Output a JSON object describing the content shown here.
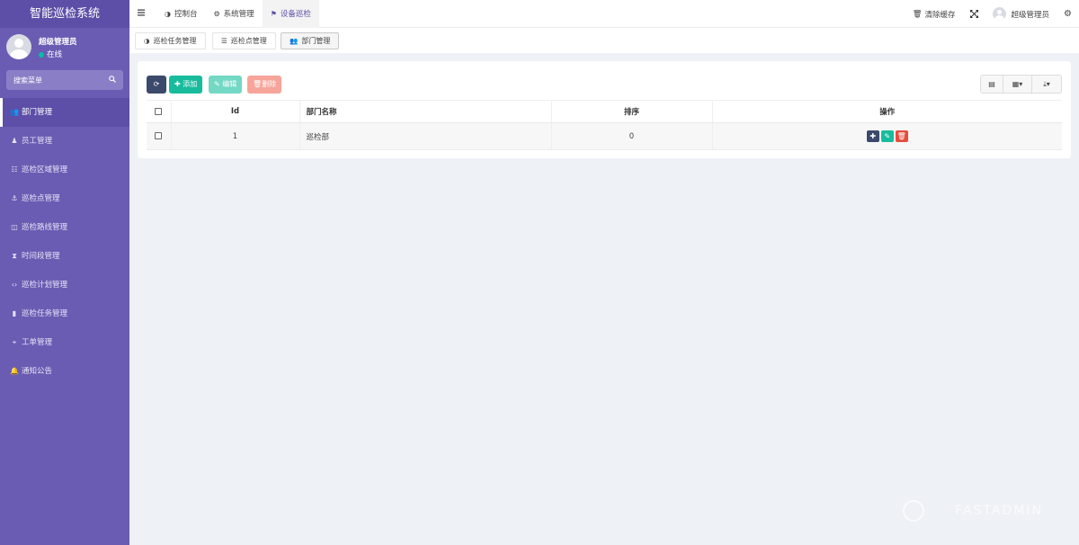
{
  "app": {
    "title": "智能巡检系统"
  },
  "user": {
    "name": "超级管理员",
    "status": "在线"
  },
  "search": {
    "placeholder": "搜索菜单"
  },
  "sidebar": {
    "items": [
      {
        "label": "部门管理",
        "icon": "users-icon",
        "glyph": "👥"
      },
      {
        "label": "员工管理",
        "icon": "user-icon",
        "glyph": "♟"
      },
      {
        "label": "巡检区域管理",
        "icon": "area-icon",
        "glyph": "☷"
      },
      {
        "label": "巡检点管理",
        "icon": "anchor-icon",
        "glyph": "⚓"
      },
      {
        "label": "巡检路线管理",
        "icon": "map-icon",
        "glyph": "◫"
      },
      {
        "label": "时间段管理",
        "icon": "hourglass-icon",
        "glyph": "⧗"
      },
      {
        "label": "巡检计划管理",
        "icon": "code-icon",
        "glyph": "‹›"
      },
      {
        "label": "巡检任务管理",
        "icon": "bookmark-icon",
        "glyph": "▮"
      },
      {
        "label": "工单管理",
        "icon": "crosshair-icon",
        "glyph": "⌖"
      },
      {
        "label": "通知公告",
        "icon": "bell-icon",
        "glyph": "🔔"
      }
    ]
  },
  "header": {
    "nav": [
      {
        "label": "控制台",
        "icon": "dashboard-icon",
        "glyph": "◑"
      },
      {
        "label": "系统管理",
        "icon": "cogs-icon",
        "glyph": "⚙"
      },
      {
        "label": "设备巡检",
        "icon": "flag-icon",
        "glyph": "⚑"
      }
    ],
    "clear_cache": "清除缓存",
    "user": "超级管理员"
  },
  "tabs": [
    {
      "label": "巡检任务管理",
      "icon": "dashboard-icon",
      "glyph": "◑"
    },
    {
      "label": "巡检点管理",
      "icon": "list-icon",
      "glyph": "☰"
    },
    {
      "label": "部门管理",
      "icon": "users-icon",
      "glyph": "👥"
    }
  ],
  "toolbar": {
    "add": "添加",
    "edit": "编辑",
    "delete": "删除"
  },
  "table": {
    "columns": [
      "Id",
      "部门名称",
      "排序",
      "操作"
    ],
    "rows": [
      {
        "id": "1",
        "name": "巡检部",
        "sort": "0"
      }
    ]
  },
  "watermark": "FASTADMIN"
}
